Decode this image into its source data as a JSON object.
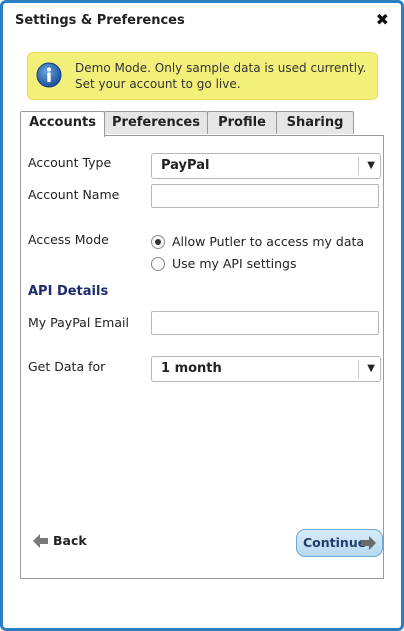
{
  "window": {
    "title": "Settings & Preferences",
    "close_glyph": "✖"
  },
  "notice": {
    "icon": "info-icon",
    "text": "Demo Mode. Only sample data is used currently. Set your account to go live."
  },
  "tabs": [
    {
      "label": "Accounts",
      "active": true
    },
    {
      "label": "Preferences",
      "active": false
    },
    {
      "label": "Profile",
      "active": false
    },
    {
      "label": "Sharing",
      "active": false
    }
  ],
  "form": {
    "account_type": {
      "label": "Account Type",
      "value": "PayPal"
    },
    "account_name": {
      "label": "Account Name",
      "value": ""
    },
    "access_mode": {
      "label": "Access Mode",
      "options": [
        {
          "label": "Allow Putler to access my data",
          "checked": true
        },
        {
          "label": "Use my API settings",
          "checked": false
        }
      ]
    },
    "api_heading": "API Details",
    "paypal_email": {
      "label": "My PayPal Email",
      "value": ""
    },
    "get_data_for": {
      "label": "Get Data for",
      "value": "1 month"
    }
  },
  "actions": {
    "back_label": "Back",
    "continue_label": "Continue"
  },
  "colors": {
    "window_border": "#2a7fc2",
    "notice_bg": "#f3f07a",
    "heading": "#1d2a6e",
    "continue_bg": "#c6e2f5"
  }
}
